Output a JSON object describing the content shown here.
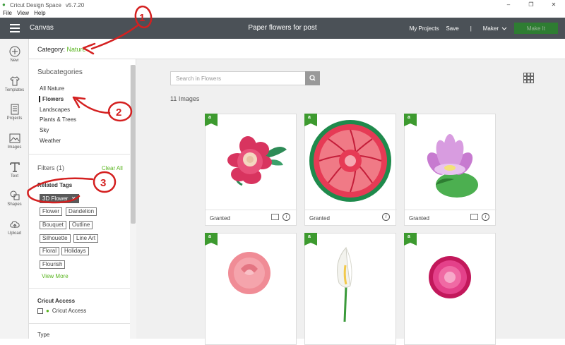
{
  "window": {
    "app_title": "Cricut Design Space",
    "version": "v5.7.20",
    "menu": [
      "File",
      "View",
      "Help"
    ],
    "controls": [
      "–",
      "❐",
      "✕"
    ]
  },
  "header": {
    "canvas_label": "Canvas",
    "project_title": "Paper flowers for post",
    "my_projects": "My Projects",
    "save": "Save",
    "separator": "|",
    "machine": "Maker",
    "make_it": "Make It"
  },
  "category": {
    "label": "Category:",
    "value": "Nature"
  },
  "left_nav": [
    {
      "label": "New",
      "icon": "plus-circle-icon"
    },
    {
      "label": "Templates",
      "icon": "shirt-icon"
    },
    {
      "label": "Projects",
      "icon": "projects-icon"
    },
    {
      "label": "Images",
      "icon": "image-icon"
    },
    {
      "label": "Text",
      "icon": "text-icon"
    },
    {
      "label": "Shapes",
      "icon": "shapes-icon"
    },
    {
      "label": "Upload",
      "icon": "upload-cloud-icon"
    }
  ],
  "panel": {
    "subcategories_heading": "Subcategories",
    "subcategories": [
      "All Nature",
      "Flowers",
      "Landscapes",
      "Plants & Trees",
      "Sky",
      "Weather"
    ],
    "selected_subcategory": "Flowers",
    "filters_heading": "Filters (1)",
    "clear_all": "Clear All",
    "related_tags_heading": "Related Tags",
    "active_tag": "3D Flower",
    "tags": [
      "Flower",
      "Dandelion",
      "Bouquet",
      "Outline",
      "Silhouette",
      "Line Art",
      "Floral",
      "Holidays",
      "Flourish"
    ],
    "view_more": "View More",
    "access_heading": "Cricut Access",
    "access_option": "Cricut Access",
    "type_heading": "Type"
  },
  "main": {
    "search_placeholder": "Search in Flowers",
    "result_count": "11 Images",
    "cards": [
      {
        "status": "Granted",
        "art": "pink-dahlia-flower"
      },
      {
        "status": "Granted",
        "art": "pink-mandala-flower"
      },
      {
        "status": "Granted",
        "art": "lotus-flower"
      },
      {
        "status": "",
        "art": "pink-rose"
      },
      {
        "status": "",
        "art": "calla-lily"
      },
      {
        "status": "",
        "art": "pink-chrysanthemum"
      }
    ]
  },
  "annotations": [
    "1",
    "2",
    "3"
  ],
  "colors": {
    "header_bg": "#4b5157",
    "accent_green": "#59b51f",
    "make_it_bg": "#2e7d32",
    "annotation_red": "#d42020"
  }
}
